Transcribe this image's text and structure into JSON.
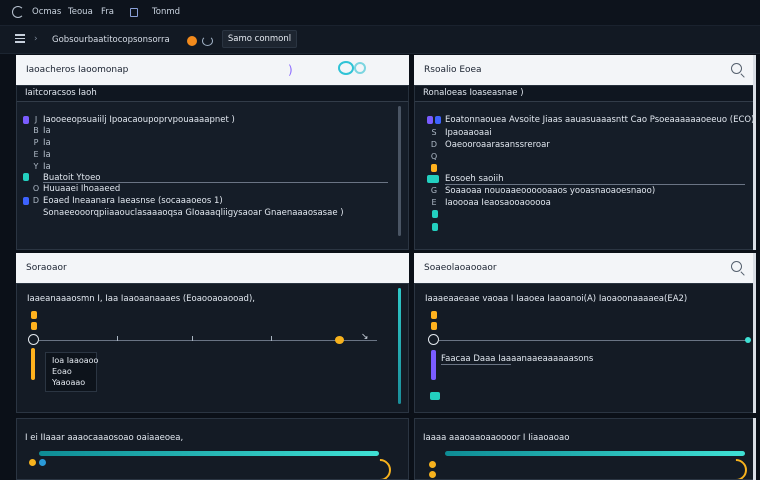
{
  "titlebar": {
    "items": [
      "Ocmas",
      "Teoua",
      "Fra",
      "Tonmd"
    ]
  },
  "toolbar": {
    "path": "Gobsourbaatitocopsonsorra",
    "button_label": "Samo conmonl"
  },
  "panels": {
    "top_left": {
      "header": "Iaoacheros Iaoomonap",
      "subbar": "Iaitcoracsos Iaoh",
      "lines": [
        "Iaooeeopsuaiilj Ipoacaoupoprvpouaaaapnet )",
        "Ia",
        "Ia",
        "Ia",
        "Ia",
        "Buatoit Ytoeo",
        "Huuaaei Ihoaaeed",
        "Eoaed Ineaanara Iaeasnse (socaaaoeos 1)",
        "Sonaeeooorqpiiaaouclasaaaoqsa GIoaaaqliigysaoar Gnaenaaaosasae )"
      ],
      "gutter": [
        "J",
        "B",
        "P",
        "E",
        "Y",
        "O",
        "D"
      ]
    },
    "top_right": {
      "header": "Rsoalio Eoea",
      "subbar": "Ronaloeas Ioaseasnae )",
      "lines": [
        "Eoatonnaouea Avsoite Jiaas aauasuaaasntt Cao Psoeaaaaaaoeeuo (ECO)",
        "Ipaoaaoaai",
        "Oaeooroaarasanssreroar",
        "Eosoeh saoiih",
        "Soaaoaa nouoaaeoooooaaos yooasnaoaoesnaoo)",
        "Iaoooaa Ieaosaooaooooa"
      ],
      "gutter": [
        "S",
        "D",
        "Q",
        "G",
        "E"
      ]
    },
    "mid_left": {
      "header": "Soraoaor",
      "subbar": "Iaaeanaaaosmn I, Iaa Iaaoaanaaaes (Eoaooaoaooad),",
      "tooltip": [
        "Ioa Iaaoaoo",
        "Eoao",
        "Yaaoaao"
      ]
    },
    "mid_right": {
      "header": "Soaeolaoaooaor",
      "subbar": "Iaaaeaaeaae vaoaa I Iaaoea Iaaoanoi(A) Iaoaoonaaaaea(EA2)",
      "legend": "Faacaa Daaa Iaaaanaaeaaaaaasons"
    },
    "bottom_left": {
      "header": "I ei IIaaar aaaocaaaosoao oaiaaeoea,"
    },
    "bottom_right": {
      "header": "Iaaaa aaaoaaoaaoooor I Iiaaoaoao"
    }
  }
}
